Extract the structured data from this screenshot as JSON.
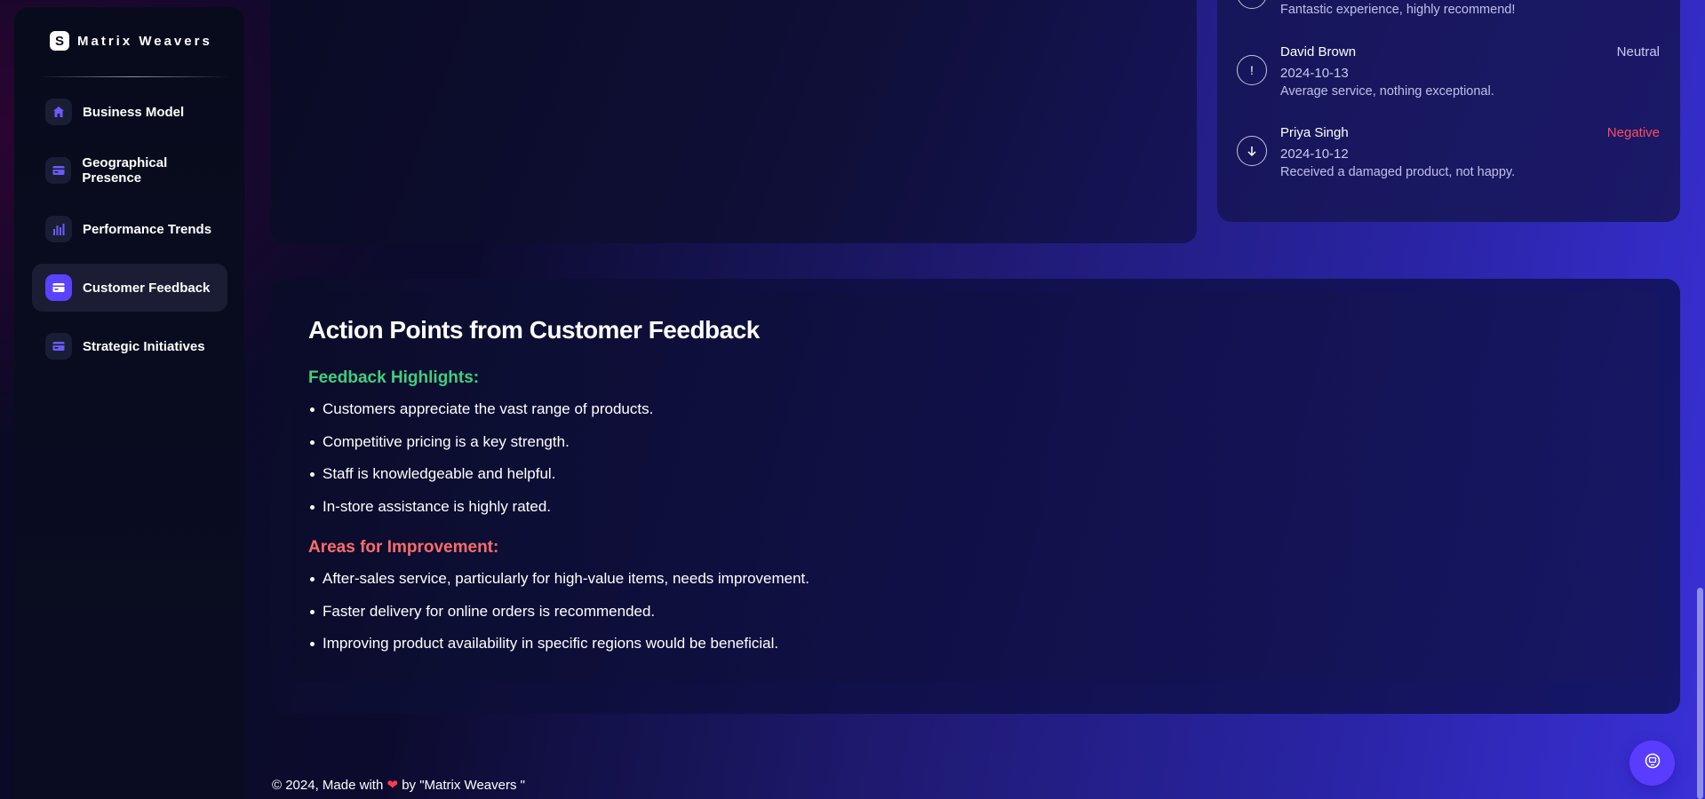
{
  "brand": {
    "logo_letter": "S",
    "name": "Matrix Weavers"
  },
  "sidebar": {
    "items": [
      {
        "label": "Business Model",
        "icon": "home-icon",
        "active": false
      },
      {
        "label": "Geographical Presence",
        "icon": "card-icon",
        "active": false
      },
      {
        "label": "Performance Trends",
        "icon": "bar-chart-icon",
        "active": false
      },
      {
        "label": "Customer Feedback",
        "icon": "card-icon",
        "active": true
      },
      {
        "label": "Strategic Initiatives",
        "icon": "card-icon",
        "active": false
      }
    ]
  },
  "reviews": [
    {
      "name": "",
      "sentiment": "",
      "date": "",
      "text": "Fantastic experience, highly recommend!",
      "icon": "arrow-up-icon"
    },
    {
      "name": "David Brown",
      "sentiment": "Neutral",
      "sentiment_color": "#c9c9ef",
      "date": "2024-10-13",
      "text": "Average service, nothing exceptional.",
      "icon": "exclamation-icon"
    },
    {
      "name": "Priya Singh",
      "sentiment": "Negative",
      "sentiment_color": "#ff4d5e",
      "date": "2024-10-12",
      "text": "Received a damaged product, not happy.",
      "icon": "arrow-down-icon"
    }
  ],
  "action_points": {
    "title": "Action Points from Customer Feedback",
    "highlights": {
      "heading": "Feedback Highlights:",
      "color": "#3fd07a",
      "items": [
        "Customers appreciate the vast range of products.",
        "Competitive pricing is a key strength.",
        "Staff is knowledgeable and helpful.",
        "In-store assistance is highly rated."
      ]
    },
    "improvements": {
      "heading": "Areas for Improvement:",
      "color": "#ff6b6b",
      "items": [
        "After-sales service, particularly for high-value items, needs improvement.",
        "Faster delivery for online orders is recommended.",
        "Improving product availability in specific regions would be beneficial."
      ]
    }
  },
  "footer": {
    "prefix": "© 2024, Made with",
    "heart": "❤",
    "suffix": "by \"Matrix Weavers \""
  },
  "fab": {
    "icon": "help-chat-icon"
  },
  "colors": {
    "accent": "#5a3cff",
    "active_icon_bg": "#5a43ff",
    "nav_icon_color": "#6b5bff"
  }
}
